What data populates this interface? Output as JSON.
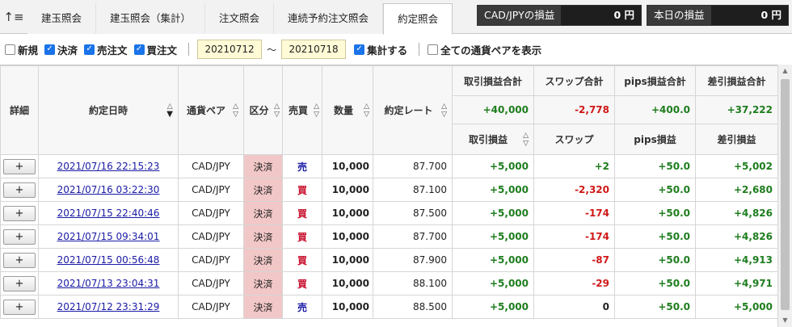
{
  "toolbar": {
    "sort_icon": "↑≡"
  },
  "tabs": [
    {
      "label": "建玉照会"
    },
    {
      "label": "建玉照会（集計）"
    },
    {
      "label": "注文照会"
    },
    {
      "label": "連続予約注文照会"
    },
    {
      "label": "約定照会"
    }
  ],
  "pl_boxes": {
    "pair": {
      "label": "CAD/JPYの損益",
      "value": "0 円"
    },
    "today": {
      "label": "本日の損益",
      "value": "0 円"
    }
  },
  "filters": {
    "shinki": "新規",
    "kessai": "決済",
    "uri": "売注文",
    "kai": "買注文",
    "date_from": "20210712",
    "tilde": "～",
    "date_to": "20210718",
    "shukei": "集計する",
    "all_pairs": "全ての通貨ペアを表示"
  },
  "headers": {
    "detail": "詳細",
    "datetime": "約定日時",
    "pair": "通貨ペア",
    "kubun": "区分",
    "side": "売買",
    "qty": "数量",
    "rate": "約定レート",
    "trade_total": "取引損益合計",
    "swap_total": "スワップ合計",
    "pips_total": "pips損益合計",
    "net_total": "差引損益合計",
    "trade": "取引損益",
    "swap": "スワップ",
    "pips": "pips損益",
    "net": "差引損益"
  },
  "totals": {
    "trade": "+40,000",
    "swap": "-2,778",
    "pips": "+400.0",
    "net": "+37,222"
  },
  "rows": [
    {
      "plus": "+",
      "datetime": "2021/07/16 22:15:23",
      "pair": "CAD/JPY",
      "kubun": "決済",
      "side": "売",
      "qty": "10,000",
      "rate": "87.700",
      "trade": "+5,000",
      "swap": "+2",
      "pips": "+50.0",
      "net": "+5,002"
    },
    {
      "plus": "+",
      "datetime": "2021/07/16 03:22:30",
      "pair": "CAD/JPY",
      "kubun": "決済",
      "side": "買",
      "qty": "10,000",
      "rate": "87.100",
      "trade": "+5,000",
      "swap": "-2,320",
      "pips": "+50.0",
      "net": "+2,680"
    },
    {
      "plus": "+",
      "datetime": "2021/07/15 22:40:46",
      "pair": "CAD/JPY",
      "kubun": "決済",
      "side": "買",
      "qty": "10,000",
      "rate": "87.500",
      "trade": "+5,000",
      "swap": "-174",
      "pips": "+50.0",
      "net": "+4,826"
    },
    {
      "plus": "+",
      "datetime": "2021/07/15 09:34:01",
      "pair": "CAD/JPY",
      "kubun": "決済",
      "side": "買",
      "qty": "10,000",
      "rate": "87.700",
      "trade": "+5,000",
      "swap": "-174",
      "pips": "+50.0",
      "net": "+4,826"
    },
    {
      "plus": "+",
      "datetime": "2021/07/15 00:56:48",
      "pair": "CAD/JPY",
      "kubun": "決済",
      "side": "買",
      "qty": "10,000",
      "rate": "87.900",
      "trade": "+5,000",
      "swap": "-87",
      "pips": "+50.0",
      "net": "+4,913"
    },
    {
      "plus": "+",
      "datetime": "2021/07/13 23:04:31",
      "pair": "CAD/JPY",
      "kubun": "決済",
      "side": "買",
      "qty": "10,000",
      "rate": "88.100",
      "trade": "+5,000",
      "swap": "-29",
      "pips": "+50.0",
      "net": "+4,971"
    },
    {
      "plus": "+",
      "datetime": "2021/07/12 23:31:29",
      "pair": "CAD/JPY",
      "kubun": "決済",
      "side": "売",
      "qty": "10,000",
      "rate": "88.500",
      "trade": "+5,000",
      "swap": "0",
      "pips": "+50.0",
      "net": "+5,000"
    }
  ]
}
